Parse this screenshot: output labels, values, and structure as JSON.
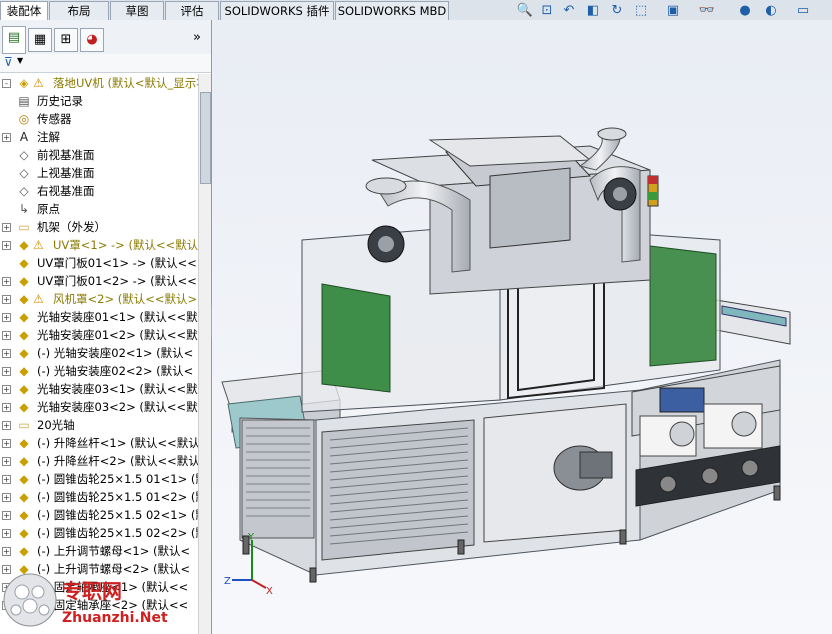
{
  "command_tabs": [
    "装配体",
    "布局",
    "草图",
    "评估",
    "SOLIDWORKS 插件",
    "SOLIDWORKS MBD"
  ],
  "view_tools": [
    "zoom-to-fit-icon",
    "zoom-area-icon",
    "previous-view-icon",
    "section-view-icon",
    "dynamic-annotation-icon",
    "view-orientation-icon",
    "display-style-icon",
    "hide-show-icon",
    "appearance-icon",
    "scene-icon",
    "display-settings-icon"
  ],
  "panel_tabs": [
    "feature-manager",
    "property-manager",
    "configuration-manager",
    "display-manager"
  ],
  "panel_expand": "»",
  "filter": "▼",
  "tree": [
    {
      "label": "落地UV机 (默认<默认_显示状",
      "icon": "assembly-icon",
      "warn": true,
      "expander": "-"
    },
    {
      "label": "历史记录",
      "icon": "history-icon",
      "warn": false,
      "expander": ""
    },
    {
      "label": "传感器",
      "icon": "sensor-icon",
      "warn": false,
      "expander": ""
    },
    {
      "label": "注解",
      "icon": "annotation-icon",
      "warn": false,
      "expander": "+"
    },
    {
      "label": "前视基准面",
      "icon": "plane-icon",
      "warn": false,
      "expander": ""
    },
    {
      "label": "上视基准面",
      "icon": "plane-icon",
      "warn": false,
      "expander": ""
    },
    {
      "label": "右视基准面",
      "icon": "plane-icon",
      "warn": false,
      "expander": ""
    },
    {
      "label": "原点",
      "icon": "origin-icon",
      "warn": false,
      "expander": ""
    },
    {
      "label": "机架（外发）",
      "icon": "folder-icon",
      "warn": false,
      "expander": "+"
    },
    {
      "label": "UV罩<1> -> (默认<<默认",
      "icon": "part-icon",
      "warn": true,
      "expander": "+"
    },
    {
      "label": "UV罩门板01<1> -> (默认<<",
      "icon": "part-icon",
      "warn": false,
      "expander": ""
    },
    {
      "label": "UV罩门板01<2> -> (默认<<",
      "icon": "part-icon",
      "warn": false,
      "expander": "+"
    },
    {
      "label": "风机罩<2> (默认<<默认>",
      "icon": "part-icon",
      "warn": true,
      "expander": "+"
    },
    {
      "label": "光轴安装座01<1> (默认<<默",
      "icon": "part-icon",
      "warn": false,
      "expander": "+"
    },
    {
      "label": "光轴安装座01<2> (默认<<默",
      "icon": "part-icon",
      "warn": false,
      "expander": "+"
    },
    {
      "label": "(-) 光轴安装座02<1> (默认<",
      "icon": "part-icon",
      "warn": false,
      "expander": "+"
    },
    {
      "label": "(-) 光轴安装座02<2> (默认<",
      "icon": "part-icon",
      "warn": false,
      "expander": "+"
    },
    {
      "label": "光轴安装座03<1> (默认<<默",
      "icon": "part-icon",
      "warn": false,
      "expander": "+"
    },
    {
      "label": "光轴安装座03<2> (默认<<默",
      "icon": "part-icon",
      "warn": false,
      "expander": "+"
    },
    {
      "label": "20光轴",
      "icon": "folder-icon",
      "warn": false,
      "expander": "+"
    },
    {
      "label": "(-) 升降丝杆<1> (默认<<默认",
      "icon": "part-icon",
      "warn": false,
      "expander": "+"
    },
    {
      "label": "(-) 升降丝杆<2> (默认<<默认",
      "icon": "part-icon",
      "warn": false,
      "expander": "+"
    },
    {
      "label": "(-) 圆锥齿轮25×1.5 01<1> (默",
      "icon": "part-icon",
      "warn": false,
      "expander": "+"
    },
    {
      "label": "(-) 圆锥齿轮25×1.5 01<2> (默",
      "icon": "part-icon",
      "warn": false,
      "expander": "+"
    },
    {
      "label": "(-) 圆锥齿轮25×1.5 02<1> (默",
      "icon": "part-icon",
      "warn": false,
      "expander": "+"
    },
    {
      "label": "(-) 圆锥齿轮25×1.5 02<2> (默",
      "icon": "part-icon",
      "warn": false,
      "expander": "+"
    },
    {
      "label": "(-) 上升调节螺母<1> (默认<",
      "icon": "part-icon",
      "warn": false,
      "expander": "+"
    },
    {
      "label": "(-) 上升调节螺母<2> (默认<",
      "icon": "part-icon",
      "warn": false,
      "expander": "+"
    },
    {
      "label": "(-) 固定轴承座<1> (默认<<",
      "icon": "part-icon",
      "warn": false,
      "expander": "+"
    },
    {
      "label": "(-) 固定轴承座<2> (默认<<",
      "icon": "part-icon",
      "warn": false,
      "expander": "+"
    }
  ],
  "triad": {
    "x": "X",
    "y": "Y",
    "z": "Z"
  },
  "watermark": {
    "title": "专职网",
    "url": "Zhuanzhi.Net"
  },
  "colors": {
    "accent": "#1f5fa8",
    "warning": "#e8b400",
    "panel_green": "#3f8f46",
    "frame": "#5f6670"
  }
}
